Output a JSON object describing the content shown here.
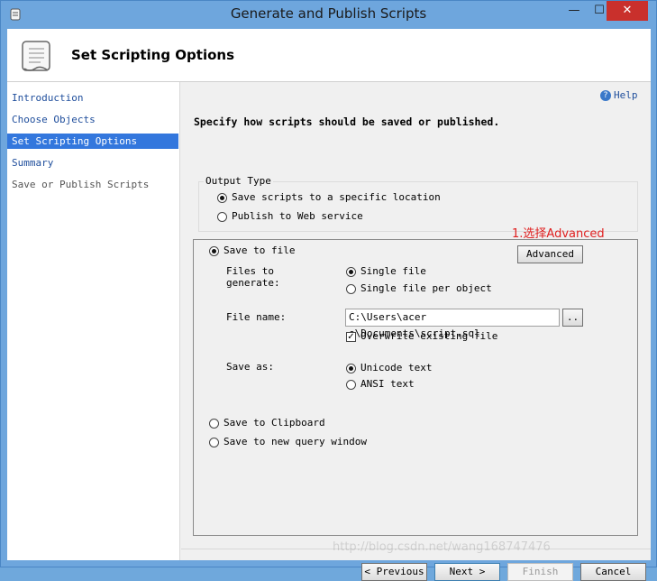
{
  "window": {
    "title": "Generate and Publish Scripts",
    "minimize": "—",
    "maximize": "☐",
    "close": "✕"
  },
  "header": {
    "title": "Set Scripting Options"
  },
  "nav": {
    "items": [
      {
        "label": "Introduction"
      },
      {
        "label": "Choose Objects"
      },
      {
        "label": "Set Scripting Options"
      },
      {
        "label": "Summary"
      },
      {
        "label": "Save or Publish Scripts"
      }
    ]
  },
  "help": {
    "label": "Help"
  },
  "instruction": "Specify how scripts should be saved or published.",
  "output_type": {
    "legend": "Output Type",
    "options": [
      {
        "label": "Save scripts to a specific location",
        "selected": true
      },
      {
        "label": "Publish to Web service",
        "selected": false
      }
    ]
  },
  "save_to_file": {
    "label": "Save to file",
    "advanced_button": "Advanced",
    "files_to_generate_label_1": "Files to",
    "files_to_generate_label_2": "generate:",
    "single_file": "Single file",
    "single_file_per_object": "Single file per object",
    "file_name_label": "File name:",
    "file_name_value": "C:\\Users\\acer e\\Documents\\script.sql",
    "browse_button": "..",
    "overwrite_label": "Overwrite existing file",
    "overwrite_checked": true,
    "save_as_label": "Save as:",
    "unicode_text": "Unicode text",
    "ansi_text": "ANSI text"
  },
  "other_options": {
    "clipboard": "Save to Clipboard",
    "query_window": "Save to new query window"
  },
  "annotation": "1.选择Advanced",
  "footer": {
    "previous": "< Previous",
    "next": "Next >",
    "finish": "Finish",
    "cancel": "Cancel"
  },
  "watermark": "http://blog.csdn.net/wang168747476"
}
